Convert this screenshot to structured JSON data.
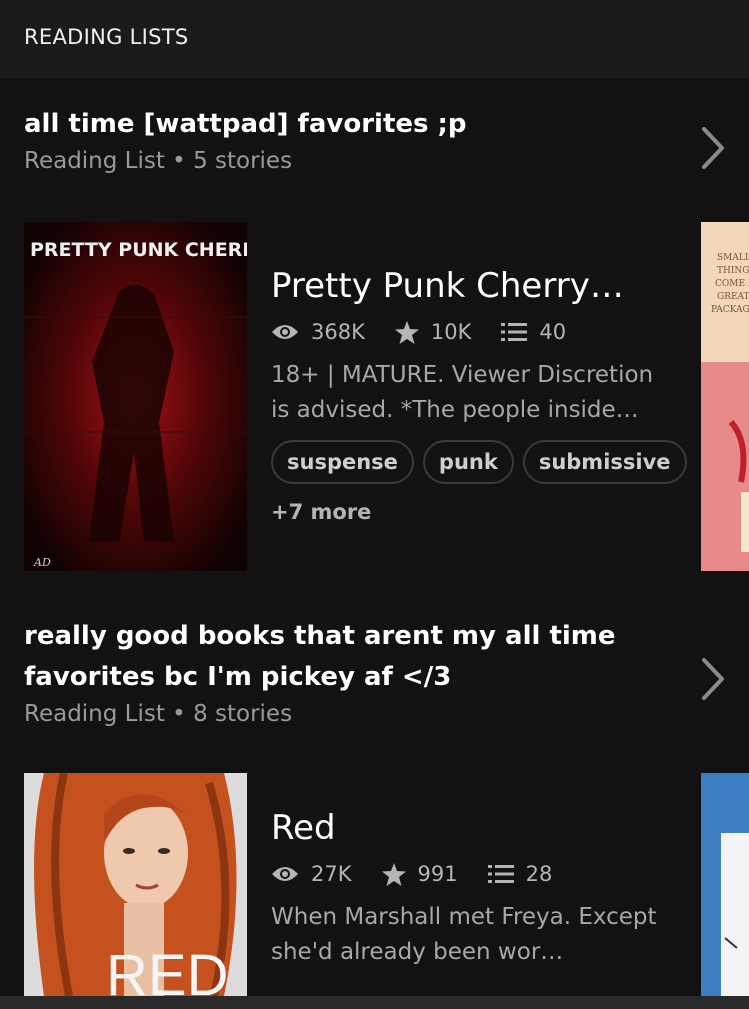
{
  "header": {
    "title": "READING LISTS"
  },
  "lists": [
    {
      "name": "all time [wattpad] favorites ;p",
      "meta": "Reading List • 5 stories",
      "story": {
        "title": "Pretty Punk Cherry…",
        "cover_text": "PRETTY PUNK CHERRY",
        "cover_sig": "AD",
        "reads": "368K",
        "votes": "10K",
        "parts": "40",
        "description": "18+ | MATURE. Viewer Discretion is advised. *The people inside…",
        "tags": [
          "suspense",
          "punk",
          "submissive"
        ],
        "more": "+7 more"
      },
      "peek_cover_text": [
        "SMALL",
        "THINGS",
        "COME IN",
        "GREAT",
        "PACKAGE"
      ]
    },
    {
      "name": "really good books that arent my all time favorites bc I'm pickey af </3",
      "meta": "Reading List • 8 stories",
      "story": {
        "title": "Red",
        "cover_text": "RED",
        "reads": "27K",
        "votes": "991",
        "parts": "28",
        "description": "When Marshall met Freya. Except she'd already been wor…"
      }
    }
  ],
  "colors": {
    "background": "#121212",
    "topbar": "#1b1b1b",
    "muted_text": "#9a9a9a",
    "tag_border": "#3a3a3a"
  }
}
